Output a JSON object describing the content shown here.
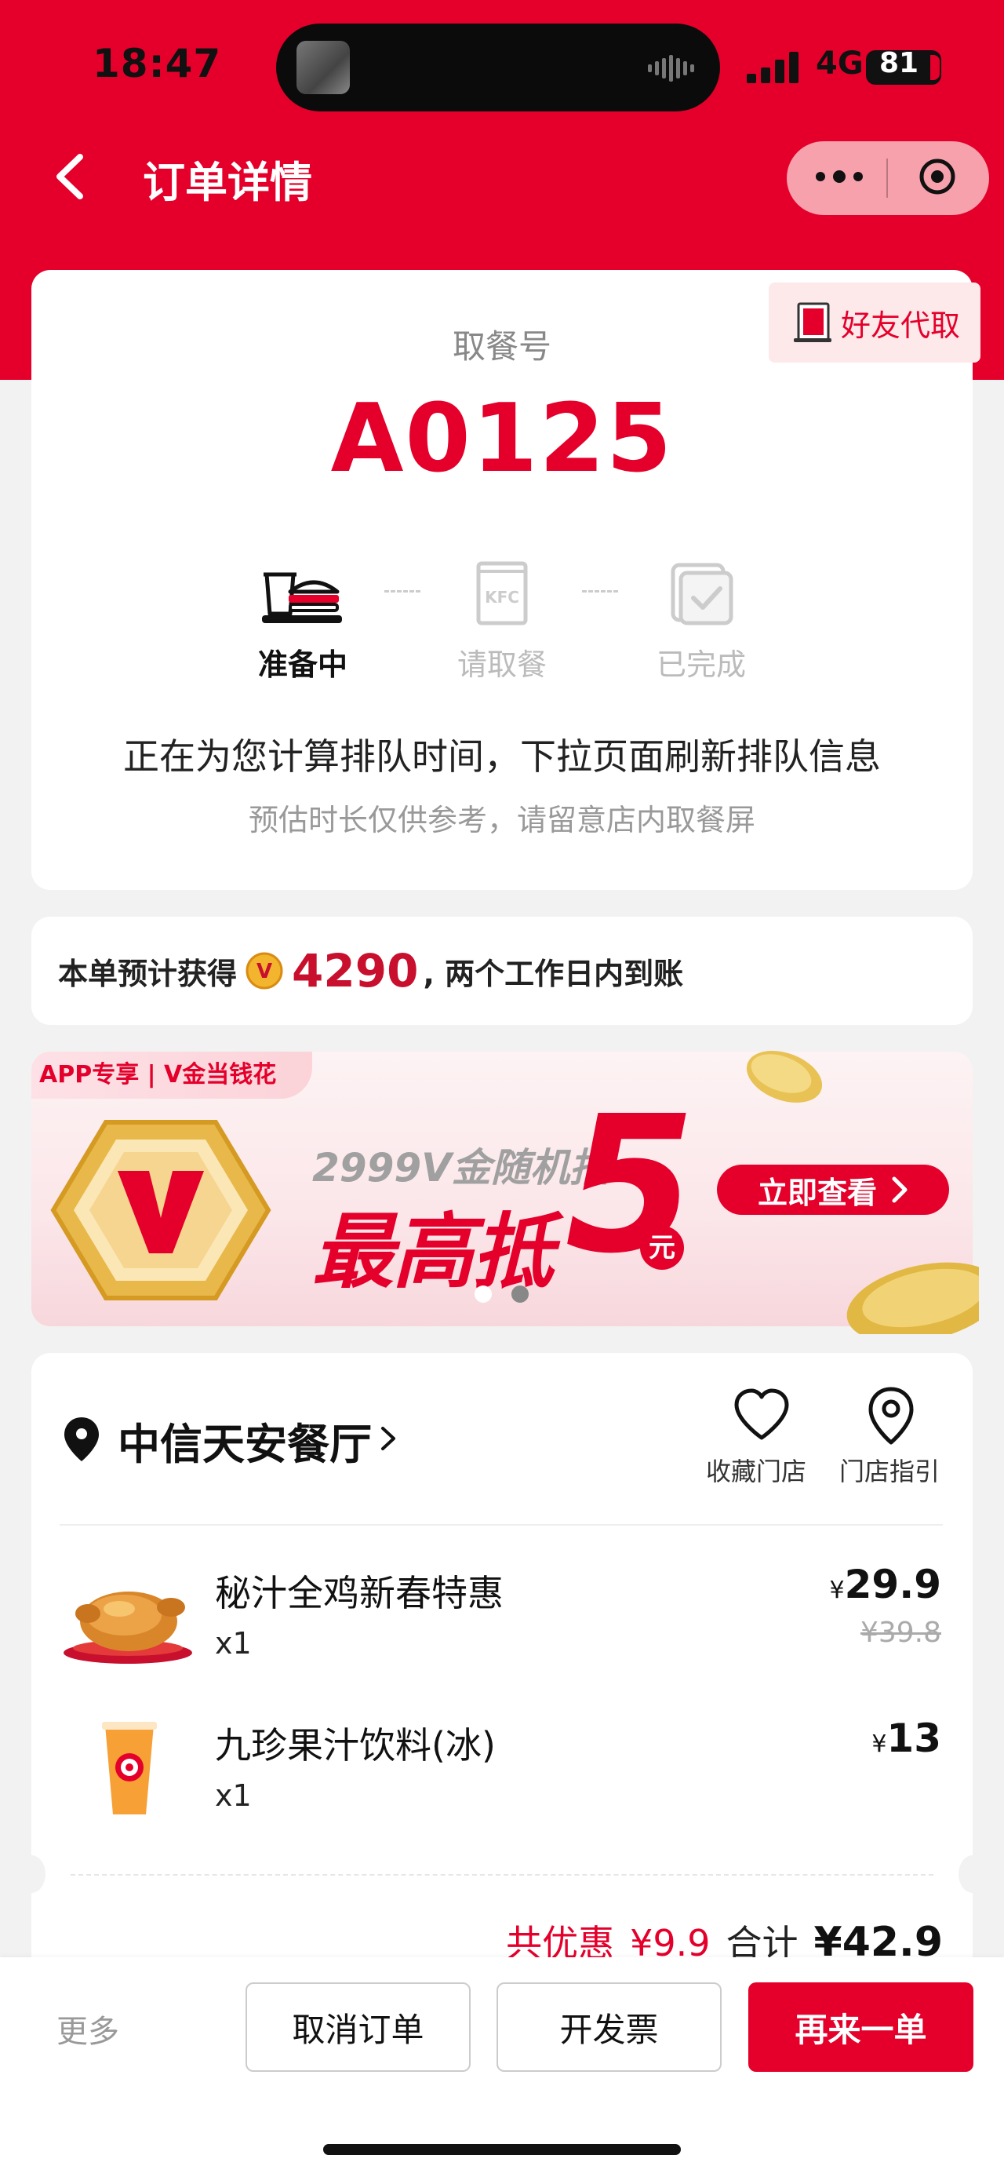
{
  "status_bar": {
    "time": "18:47",
    "network": "4G",
    "battery": "81"
  },
  "header": {
    "title": "订单详情",
    "more_icon": "more-dots-icon",
    "close_icon": "target-icon"
  },
  "pickup": {
    "friend_pickup": "好友代取",
    "label": "取餐号",
    "number": "A0125",
    "steps": [
      {
        "label": "准备中",
        "icon": "preparing-burger-icon",
        "active": true
      },
      {
        "label": "请取餐",
        "icon": "kfc-bag-icon",
        "active": false
      },
      {
        "label": "已完成",
        "icon": "completed-check-icon",
        "active": false
      }
    ],
    "queue_message": "正在为您计算排队时间，下拉页面刷新排队信息",
    "queue_note": "预估时长仅供参考，请留意店内取餐屏"
  },
  "points": {
    "prefix": "本单预计获得",
    "amount": "4290",
    "suffix": ", 两个工作日内到账"
  },
  "banner": {
    "tag": "APP专享 | V金当钱花",
    "subtitle": "2999V金随机抽",
    "headline": "最高抵",
    "big_number": "5",
    "unit": "元",
    "button": "立即查看",
    "active_slide": 1,
    "slide_count": 2
  },
  "store": {
    "name": "中信天安餐厅",
    "favorite_label": "收藏门店",
    "guide_label": "门店指引"
  },
  "items": [
    {
      "name": "秘汁全鸡新春特惠",
      "qty": "x1",
      "currency": "¥",
      "price": "29.9",
      "original_price": "¥39.8"
    },
    {
      "name": "九珍果汁饮料(冰)",
      "qty": "x1",
      "currency": "¥",
      "price": "13"
    }
  ],
  "summary": {
    "discount_label": "共优惠",
    "discount_amount": "¥9.9",
    "total_label": "合计",
    "total_amount": "¥42.9"
  },
  "actions": {
    "more": "更多",
    "cancel": "取消订单",
    "invoice": "开发票",
    "reorder": "再来一单"
  },
  "colors": {
    "brand_red": "#e4002b",
    "background": "#f2f2f2"
  }
}
